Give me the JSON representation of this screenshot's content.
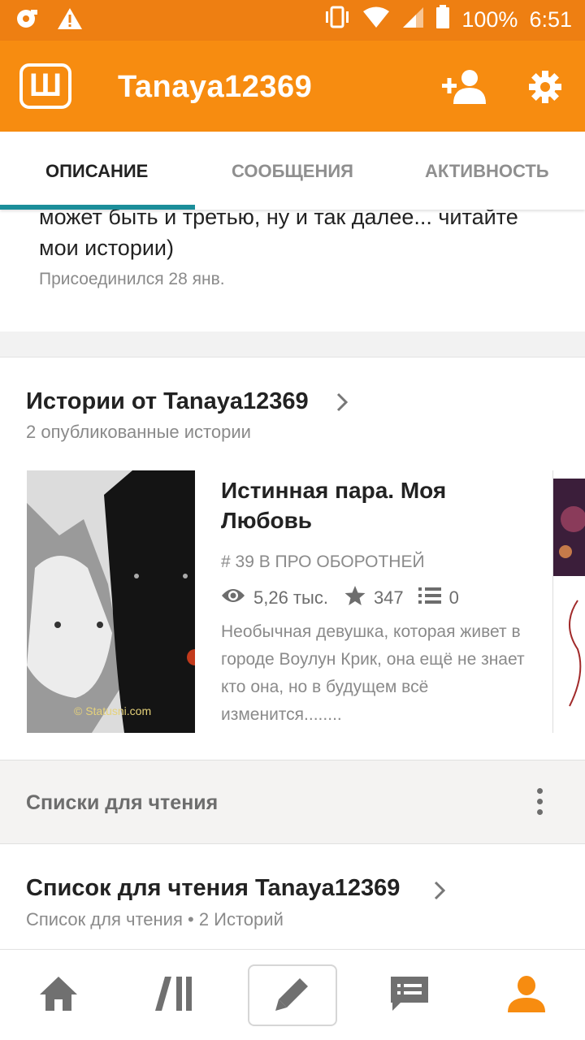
{
  "status_bar": {
    "battery": "100%",
    "time": "6:51",
    "left_icons": [
      "sync-icon",
      "warning-icon"
    ],
    "right_icons": [
      "vibrate-icon",
      "wifi-icon",
      "signal-icon",
      "battery-icon"
    ]
  },
  "app_bar": {
    "logo": "Ш",
    "title": "Tanaya12369",
    "icons": [
      "add-user-icon",
      "gear-icon"
    ],
    "color": "#f78c10"
  },
  "tabs": [
    {
      "label": "ОПИСАНИЕ",
      "active": true
    },
    {
      "label": "СООБЩЕНИЯ",
      "active": false
    },
    {
      "label": "АКТИВНОСТЬ",
      "active": false
    }
  ],
  "description": {
    "text": "может быть и третью, ну и так далее... читайте мои истории)",
    "joined": "Присоединился 28 янв."
  },
  "stories": {
    "title": "Истории от Tanaya12369",
    "count": "2 опубликованные истории",
    "items": [
      {
        "cover_watermark": "© Statusni.com",
        "title": "Истинная пара. Моя Любовь",
        "rank": "# 39 В ПРО ОБОРОТНЕЙ",
        "views": "5,26 тыс.",
        "votes": "347",
        "parts": "0",
        "description": "Необычная девушка, которая живет в городе Воулун Крик, она ещё не знает кто она, но в будущем всё изменится........"
      }
    ]
  },
  "reading_lists": {
    "header": "Списки для чтения",
    "title": "Список для чтения Tanaya12369",
    "subtitle": "Список для чтения • 2 Историй"
  },
  "bottom_nav": [
    {
      "name": "home-icon",
      "active": false
    },
    {
      "name": "library-icon",
      "active": false
    },
    {
      "name": "pencil-icon",
      "active": false
    },
    {
      "name": "messages-icon",
      "active": false
    },
    {
      "name": "profile-icon",
      "active": true
    }
  ],
  "colors": {
    "accent": "#f78c10",
    "tab_indicator": "#1b8e9a",
    "nav_inactive": "#707070"
  }
}
